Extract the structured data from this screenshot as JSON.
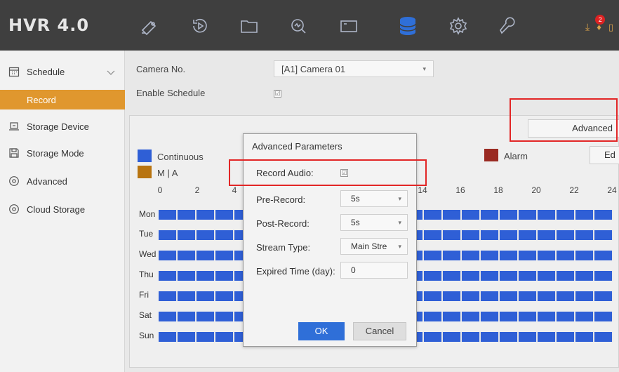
{
  "app": {
    "title": "HVR 4.0",
    "notification_count": "2"
  },
  "nav": {
    "icons": [
      "live-view-icon",
      "playback-icon",
      "file-icon",
      "search-icon",
      "camera-icon",
      "storage-icon",
      "settings-icon",
      "maintenance-icon"
    ],
    "active": "storage-icon",
    "accent": "#2f6fd8"
  },
  "sidebar": {
    "items": [
      {
        "label": "Schedule"
      },
      {
        "label": "Record"
      },
      {
        "label": "Storage Device"
      },
      {
        "label": "Storage Mode"
      },
      {
        "label": "Advanced"
      },
      {
        "label": "Cloud Storage"
      }
    ],
    "active_color": "#e0972e"
  },
  "main": {
    "camera_label": "Camera No.",
    "camera_value": "[A1] Camera 01",
    "enable_label": "Enable Schedule",
    "enable_checked": "☑",
    "advanced_label": "Advanced",
    "edit_label": "Ed",
    "legend": [
      {
        "label": "Continuous",
        "color": "#2f5fd6"
      },
      {
        "label": "M | A",
        "color": "#b87410"
      },
      {
        "label": "Alarm",
        "color": "#9a2a22"
      }
    ],
    "hours": [
      "0",
      "2",
      "4",
      "14",
      "16",
      "18",
      "20",
      "22",
      "24"
    ],
    "days": [
      "Mon",
      "Tue",
      "Wed",
      "Thu",
      "Fri",
      "Sat",
      "Sun"
    ],
    "record_color": "#2f5fd6"
  },
  "dialog": {
    "title": "Advanced Parameters",
    "record_audio_label": "Record Audio:",
    "record_audio_checked": "☑",
    "pre_record_label": "Pre-Record:",
    "pre_record_value": "5s",
    "post_record_label": "Post-Record:",
    "post_record_value": "5s",
    "stream_type_label": "Stream Type:",
    "stream_type_value": "Main Stre",
    "expired_label": "Expired Time (day):",
    "expired_value": "0",
    "ok_label": "OK",
    "cancel_label": "Cancel"
  }
}
